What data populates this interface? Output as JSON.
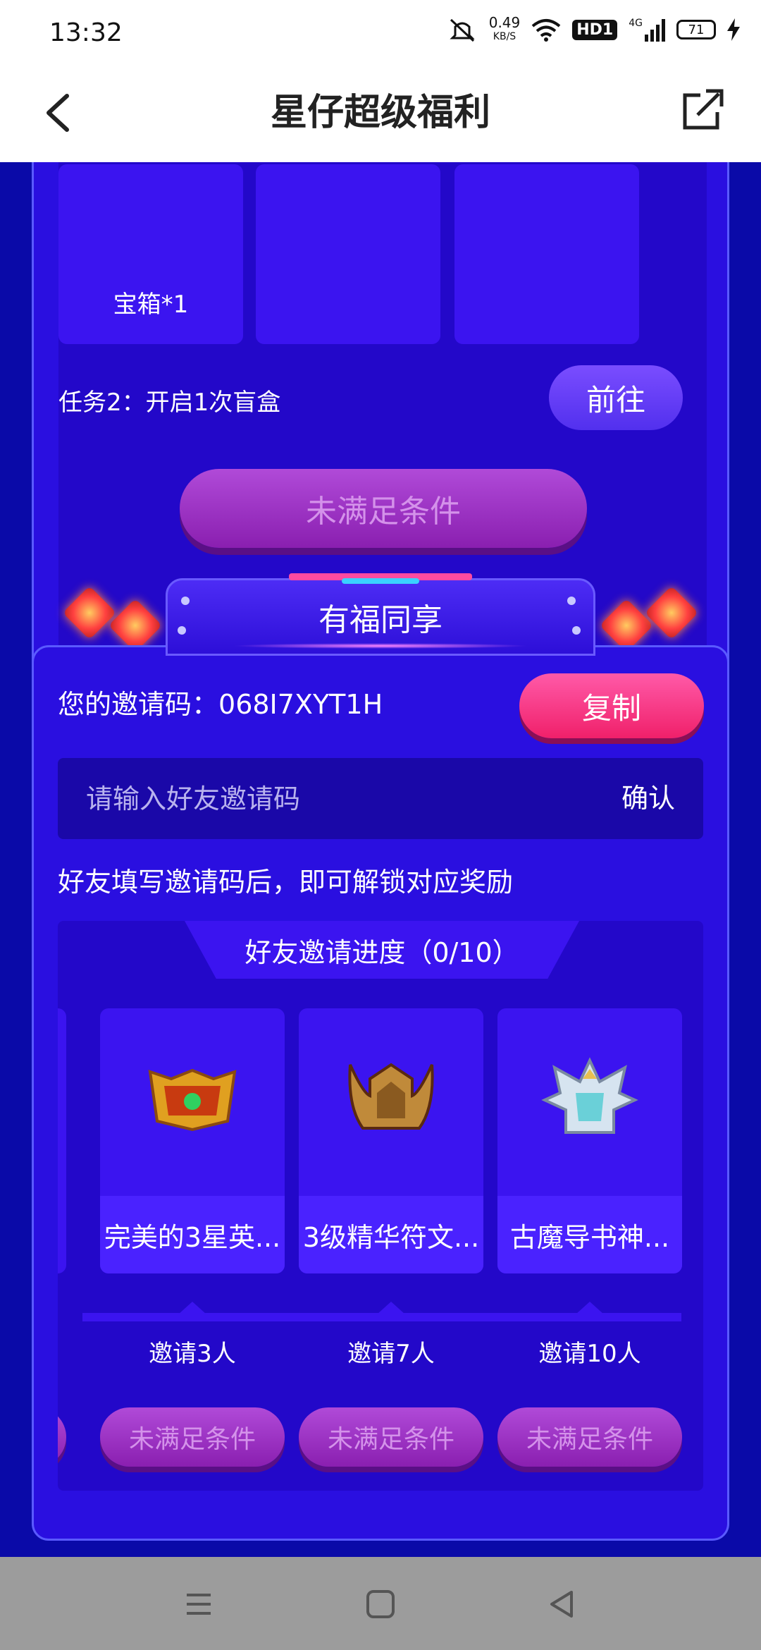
{
  "status_bar": {
    "time": "13:32",
    "net_speed": "0.49",
    "net_unit": "KB/S",
    "hd_label": "HD1",
    "signal_label": "4G",
    "battery": "71"
  },
  "header": {
    "title": "星仔超级福利"
  },
  "task_card": {
    "reward_label": "宝箱*1",
    "task2_text": "任务2：开启1次盲盒",
    "goto_label": "前往",
    "claim_label": "未满足条件"
  },
  "share_section": {
    "banner_title": "有福同享",
    "invite_code_label": "您的邀请码：",
    "invite_code": "068I7XYT1H",
    "copy_label": "复制",
    "input_placeholder": "请输入好友邀请码",
    "confirm_label": "确认",
    "tip": "好友填写邀请码后，即可解锁对应奖励",
    "progress_title": "好友邀请进度（0/10）",
    "rewards": [
      {
        "name": "完美的3星英...",
        "requirement": "邀请3人",
        "status": "未满足条件",
        "icon": "golden-shield-icon"
      },
      {
        "name": "3级精华符文...",
        "requirement": "邀请7人",
        "status": "未满足条件",
        "icon": "horned-helmet-icon"
      },
      {
        "name": "古魔导书神...",
        "requirement": "邀请10人",
        "status": "未满足条件",
        "icon": "winged-crest-icon"
      }
    ]
  },
  "nav_bar": {
    "items": [
      "menu-icon",
      "home-icon",
      "back-icon"
    ]
  }
}
